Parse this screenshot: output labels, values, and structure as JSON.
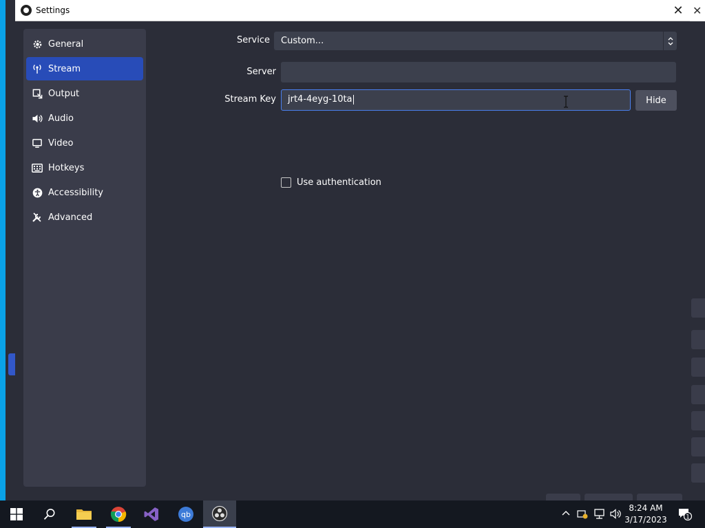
{
  "window": {
    "title": "Settings",
    "close_glyph": "✕"
  },
  "sidebar": {
    "items": [
      {
        "label": "General",
        "icon": "gear-icon",
        "active": false
      },
      {
        "label": "Stream",
        "icon": "antenna-icon",
        "active": true
      },
      {
        "label": "Output",
        "icon": "output-icon",
        "active": false
      },
      {
        "label": "Audio",
        "icon": "speaker-icon",
        "active": false
      },
      {
        "label": "Video",
        "icon": "monitor-icon",
        "active": false
      },
      {
        "label": "Hotkeys",
        "icon": "keyboard-icon",
        "active": false
      },
      {
        "label": "Accessibility",
        "icon": "accessibility-icon",
        "active": false
      },
      {
        "label": "Advanced",
        "icon": "wrench-icon",
        "active": false
      }
    ]
  },
  "stream": {
    "service_label": "Service",
    "service_value": "Custom...",
    "server_label": "Server",
    "server_value": "",
    "key_label": "Stream Key",
    "key_value": "jrt4-4eyg-10ta",
    "hide_label": "Hide",
    "auth_label": "Use authentication",
    "auth_checked": false
  },
  "taskbar": {
    "apps": [
      "start",
      "search",
      "file-explorer",
      "chrome",
      "visual-studio",
      "qbittorrent",
      "obs"
    ],
    "active_app": "obs",
    "time": "8:24 AM",
    "date": "3/17/2023",
    "notification_count": "1"
  },
  "colors": {
    "accent": "#284cb8",
    "focus_border": "#4a80f0",
    "panel": "#3a3c4a",
    "background": "#2b2d38"
  }
}
